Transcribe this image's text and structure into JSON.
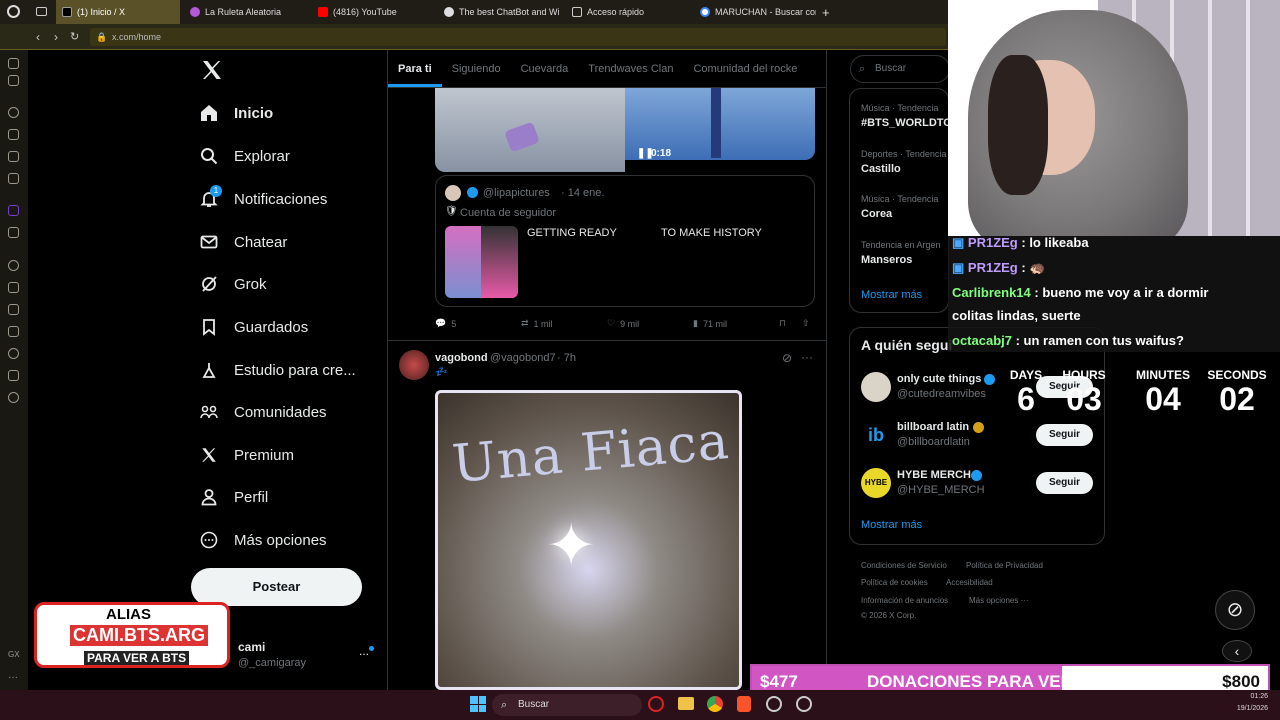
{
  "browser": {
    "tabs": [
      {
        "label": "(1) Inicio / X",
        "active": true
      },
      {
        "label": "La Ruleta Aleatoria",
        "active": false
      },
      {
        "label": "(4816) YouTube",
        "active": false
      },
      {
        "label": "The best ChatBot and Wi",
        "active": false
      },
      {
        "label": "Acceso rápido",
        "active": false
      },
      {
        "label": "MARUCHAN - Buscar con",
        "active": false
      }
    ],
    "new_tab": "+",
    "url": "x.com/home"
  },
  "sidebar": {
    "items": [
      {
        "label": "Inicio",
        "icon": "home-icon"
      },
      {
        "label": "Explorar",
        "icon": "search-icon"
      },
      {
        "label": "Notificaciones",
        "icon": "bell-icon",
        "badge": "1"
      },
      {
        "label": "Chatear",
        "icon": "mail-icon"
      },
      {
        "label": "Grok",
        "icon": "grok-icon"
      },
      {
        "label": "Guardados",
        "icon": "bookmark-icon"
      },
      {
        "label": "Estudio para cre...",
        "icon": "creator-icon"
      },
      {
        "label": "Comunidades",
        "icon": "communities-icon"
      },
      {
        "label": "Premium",
        "icon": "x-icon"
      },
      {
        "label": "Perfil",
        "icon": "person-icon"
      },
      {
        "label": "Más opciones",
        "icon": "more-circle-icon"
      }
    ],
    "post_button": "Postear",
    "account": {
      "name": "cami",
      "handle": "@_camigaray",
      "more": "..."
    }
  },
  "feed": {
    "tabs": [
      "Para ti",
      "Siguiendo",
      "Cuevarda",
      "Trendwaves Clan",
      "Comunidad del rocke"
    ],
    "video_time": "0:18",
    "quote": {
      "handle": "@lipapictures",
      "date": "· 14 ene.",
      "note": "Cuenta de seguidor",
      "text_left": "GETTING READY",
      "text_right": "TO MAKE HISTORY"
    },
    "actions": {
      "replies": "5",
      "reposts": "1 mil",
      "likes": "9 mil",
      "views": "71 mil"
    },
    "post2": {
      "name": "vagobond",
      "handle": "@vagobond7",
      "time": "· 7h",
      "text": "💤",
      "image_text": "Una Fiaca"
    }
  },
  "right": {
    "search_placeholder": "Buscar",
    "trends": [
      {
        "category": "Música · Tendencia",
        "name": "#BTS_WORLDTO"
      },
      {
        "category": "Deportes · Tendencia",
        "name": "Castillo"
      },
      {
        "category": "Música · Tendencia",
        "name": "Corea"
      },
      {
        "category": "Tendencia en Argen",
        "name": "Manseros"
      }
    ],
    "show_more": "Mostrar más",
    "who_to_follow_title": "A quién segui",
    "follow": [
      {
        "name": "only cute things",
        "handle": "@cutedreamvibes",
        "button": "Seguir"
      },
      {
        "name": "billboard latin",
        "handle": "@billboardlatin",
        "button": "Seguir"
      },
      {
        "name": "HYBE MERCH",
        "handle": "@HYBE_MERCH",
        "button": "Seguir"
      }
    ],
    "show_more_2": "Mostrar más",
    "footer": {
      "line1": [
        "Condiciones de Servicio",
        "Política de Privacidad"
      ],
      "line2": [
        "Política de cookies",
        "Accesibilidad"
      ],
      "line3": [
        "Información de anuncios",
        "Más opciones ···"
      ],
      "copyright": "© 2026 X Corp."
    }
  },
  "stream": {
    "chat": [
      {
        "user": "PR1ZEg",
        "msg": ": lo likeaba",
        "color": "#4aa8ff"
      },
      {
        "user": "PR1ZEg",
        "msg": ": 🦔",
        "color": "#4aa8ff"
      },
      {
        "user": "Carlibrenk14",
        "msg": ": bueno me voy a ir a dormir",
        "color": "#7fff7f"
      },
      {
        "user": "",
        "msg": "colitas lindas, suerte",
        "color": "#fff"
      },
      {
        "user": "octacabj7",
        "msg": ": un ramen con tus waifus?",
        "color": "#7fff7f"
      }
    ],
    "timer": {
      "days_label": "DAYS",
      "days": "6",
      "hours_label": "HOURS",
      "hours": "03",
      "minutes_label": "MINUTES",
      "minutes": "04",
      "seconds_label": "SECONDS",
      "seconds": "02"
    },
    "donation": {
      "current": "$477",
      "label": "DONACIONES PARA VER A BTS",
      "goal": "$800",
      "progress": 0.6
    },
    "promo": {
      "line1": "ALIAS",
      "line2": "CAMI.BTS.ARG",
      "line3": "PARA VER A BTS"
    }
  },
  "taskbar": {
    "search": "Buscar",
    "time": "01:26",
    "date": "19/1/2026"
  },
  "colors": {
    "accent": "#1d9bf0",
    "verified": "#1d9bf0",
    "tab_active": "#5a5128",
    "donation": "#d255c4"
  }
}
